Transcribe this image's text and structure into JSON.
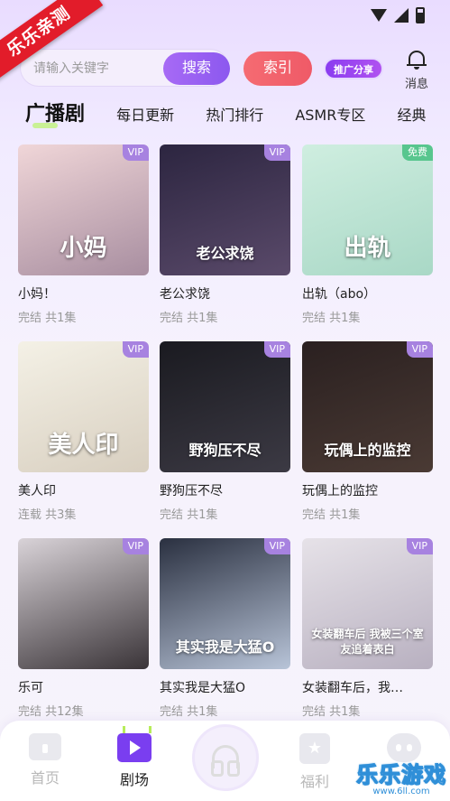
{
  "ribbon": {
    "text": "乐乐亲测"
  },
  "search": {
    "placeholder": "请输入关键字",
    "search_label": "搜索",
    "index_label": "索引",
    "promo_label": "推广分享",
    "message_label": "消息"
  },
  "tabs": [
    {
      "label": "广播剧",
      "active": true
    },
    {
      "label": "每日更新"
    },
    {
      "label": "热门排行"
    },
    {
      "label": "ASMR专区"
    },
    {
      "label": "经典"
    }
  ],
  "cards": [
    {
      "title": "小妈！",
      "meta": "完结 共1集",
      "badge": "VIP",
      "cover_text": "小妈",
      "cover_colors": [
        "#f0d6d8",
        "#a88ea0"
      ]
    },
    {
      "title": "老公求饶",
      "meta": "完结 共1集",
      "badge": "VIP",
      "cover_text": "老公求饶",
      "cover_colors": [
        "#2c2540",
        "#5a4a6a"
      ]
    },
    {
      "title": "出轨（abo）",
      "meta": "完结 共1集",
      "badge": "免费",
      "badge_free": true,
      "cover_text": "出轨",
      "cover_colors": [
        "#cfeee0",
        "#a9d8c6"
      ]
    },
    {
      "title": "美人印",
      "meta": "连载 共3集",
      "badge": "VIP",
      "cover_text": "美人印",
      "cover_colors": [
        "#f4f1e6",
        "#d8cfc0"
      ]
    },
    {
      "title": "野狗压不尽",
      "meta": "完结 共1集",
      "badge": "VIP",
      "cover_text": "野狗压不尽",
      "cover_colors": [
        "#1a1a20",
        "#3c3a44"
      ]
    },
    {
      "title": "玩偶上的监控",
      "meta": "完结 共1集",
      "badge": "VIP",
      "cover_text": "玩偶上的监控",
      "cover_colors": [
        "#2a2020",
        "#4a3a34"
      ]
    },
    {
      "title": "乐可",
      "meta": "完结 共12集",
      "badge": "VIP",
      "cover_text": "",
      "cover_colors": [
        "#d9d3d8",
        "#3a3438"
      ]
    },
    {
      "title": "其实我是大猛O",
      "meta": "完结 共1集",
      "badge": "VIP",
      "cover_text": "其实我是大猛O",
      "cover_colors": [
        "#2a3040",
        "#b8c4d8"
      ]
    },
    {
      "title": "女装翻车后，我…",
      "meta": "完结 共1集",
      "badge": "VIP",
      "cover_text": "女装翻车后 我被三个室友追着表白",
      "cover_colors": [
        "#e6e2e8",
        "#b8b0c0"
      ]
    }
  ],
  "nav": {
    "home": "首页",
    "theater": "剧场",
    "welfare": "福利"
  },
  "watermark": {
    "main": "乐乐游戏",
    "sub": "www.6ll.com"
  }
}
